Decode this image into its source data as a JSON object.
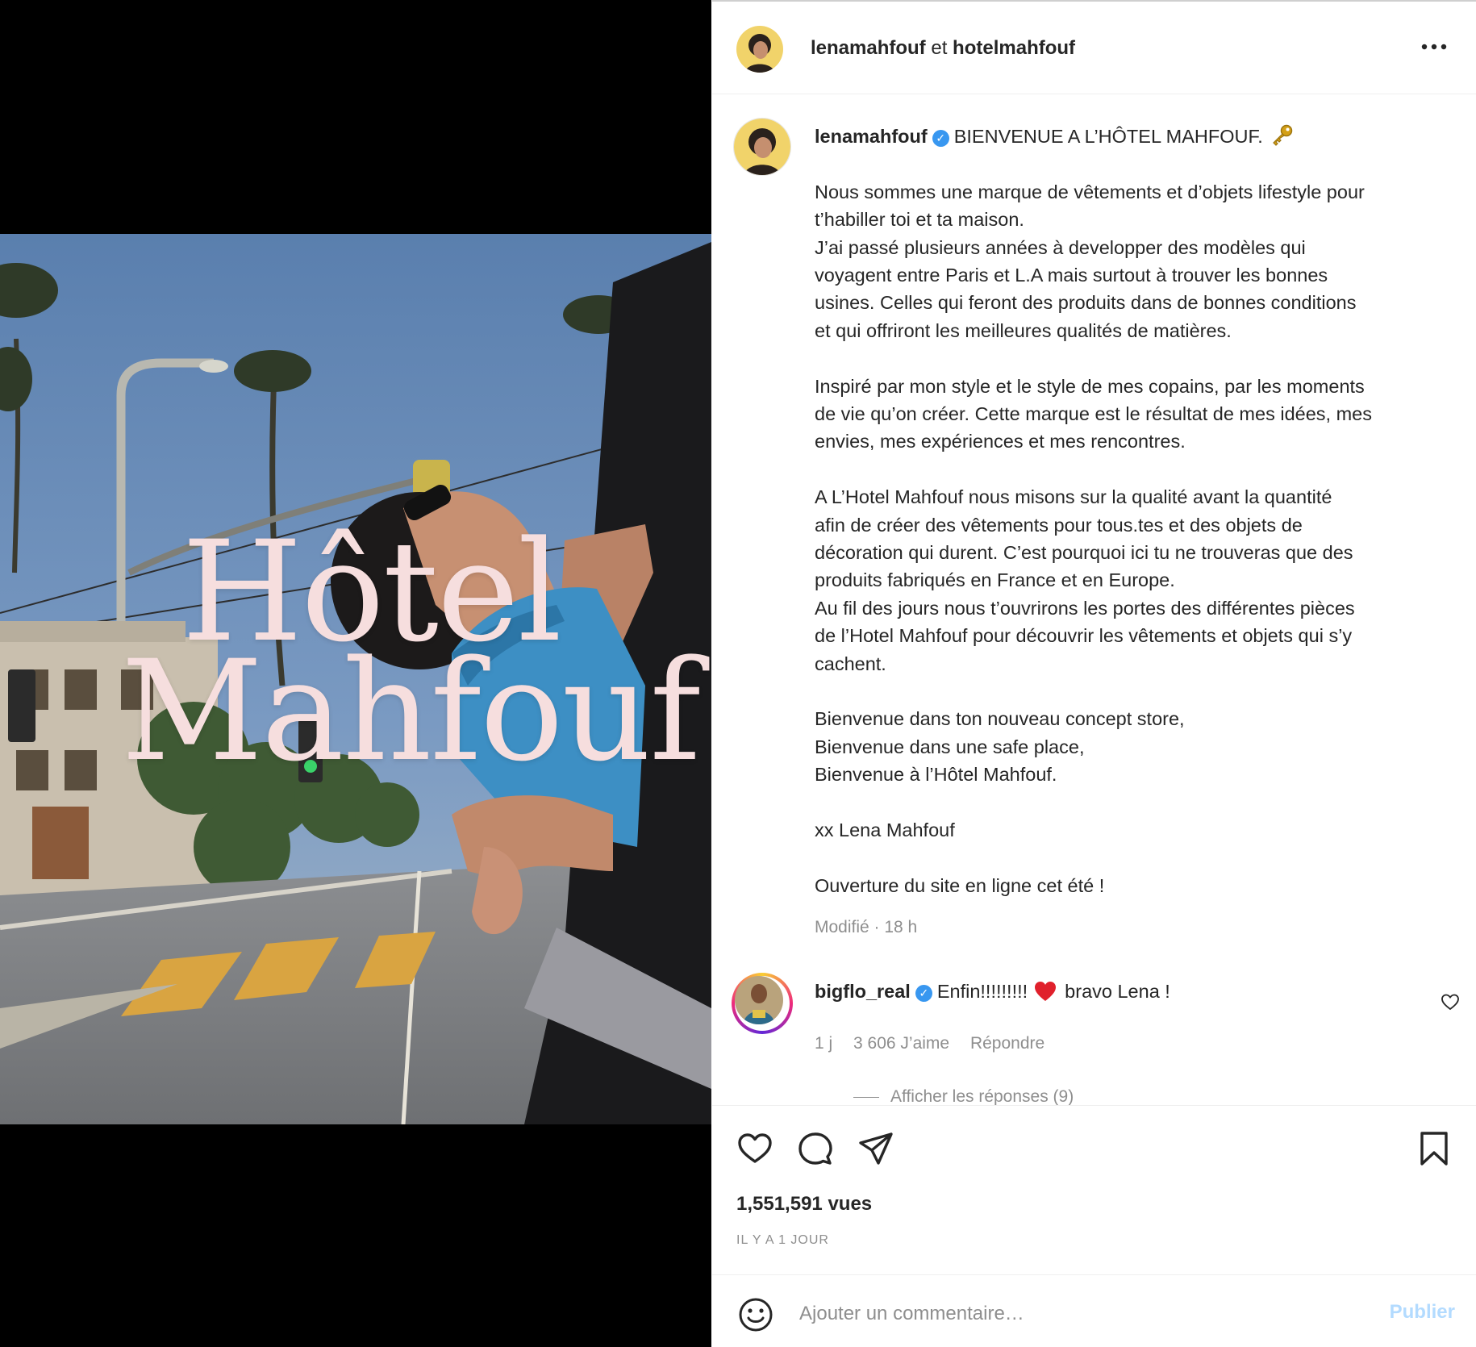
{
  "media": {
    "brand_line1": "Hôtel",
    "brand_line2": "Mahfouf"
  },
  "header": {
    "author": "lenamahfouf",
    "joiner": "et",
    "coauthor": "hotelmahfouf",
    "more_icon": "more-horizontal-icon"
  },
  "caption": {
    "username": "lenamahfouf",
    "verified": true,
    "headline": "BIENVENUE A L’HÔTEL MAHFOUF.",
    "headline_icon": "key-icon",
    "lines": [
      "Nous sommes une marque de vêtements et d’objets lifestyle pour",
      "t’habiller toi et ta maison.",
      "J’ai passé plusieurs années à developper des modèles qui",
      "voyagent entre Paris et L.A mais surtout à trouver les bonnes",
      "usines. Celles qui feront des produits dans de bonnes conditions",
      "et qui offriront les meilleures qualités de matières.",
      "",
      "Inspiré par mon style et le style de mes copains, par les moments",
      "de vie qu’on créer. Cette marque est le résultat de mes idées, mes",
      "envies, mes expériences et mes rencontres.",
      "",
      "A L’Hotel Mahfouf nous misons sur la qualité avant la quantité",
      "afin de créer des vêtements pour tous.tes et des objets de",
      "décoration qui durent. C’est pourquoi ici tu ne trouveras que des",
      "produits fabriqués en France et en Europe.",
      "Au fil des jours nous t’ouvrirons les portes des différentes pièces",
      "de l’Hotel Mahfouf pour découvrir les vêtements et objets qui s’y",
      "cachent.",
      "",
      "Bienvenue dans ton nouveau concept store,",
      "Bienvenue dans une safe place,",
      "Bienvenue à l’Hôtel Mahfouf.",
      "",
      "xx Lena Mahfouf",
      "",
      "Ouverture du site en ligne cet été !"
    ],
    "meta": "Modifié · 18 h"
  },
  "comment": {
    "username": "bigflo_real",
    "verified": true,
    "text_before": "Enfin!!!!!!!!!",
    "emoji": "red-heart",
    "text_after": "bravo Lena !",
    "time": "1 j",
    "likes": "3 606 J’aime",
    "reply": "Répondre",
    "view_replies": "Afficher les réponses (9)"
  },
  "actions": {
    "views": "1,551,591 vues",
    "time_ago": "IL Y A 1 JOUR"
  },
  "comment_box": {
    "placeholder": "Ajouter un commentaire…",
    "publish": "Publier"
  },
  "colors": {
    "verified": "#3897f0",
    "publish_disabled": "#b3dbff",
    "muted": "#8e8e8e",
    "brand_overlay": "#f6dede"
  }
}
